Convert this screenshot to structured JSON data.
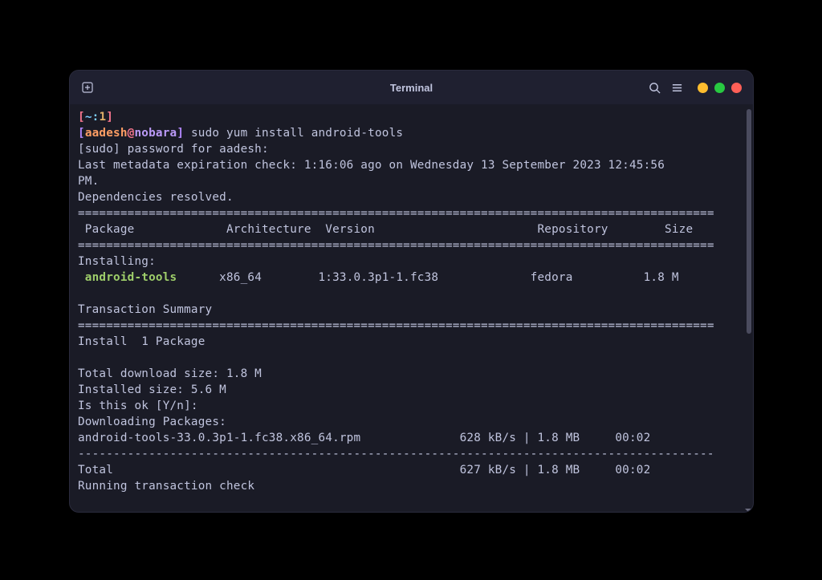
{
  "titlebar": {
    "title": "Terminal"
  },
  "prompt": {
    "open_br": "[",
    "tilde": "~",
    "colon": ":",
    "one": "1",
    "close_br": "]",
    "open_br2": "[",
    "user": "aadesh",
    "at": "@",
    "host": "nobara",
    "close_br2": "]",
    "command": " sudo yum install android-tools"
  },
  "lines": {
    "sudo_pw": "[sudo] password for aadesh:",
    "metadata": "Last metadata expiration check: 1:16:06 ago on Wednesday 13 September 2023 12:45:56",
    "pm": "PM.",
    "dep": "Dependencies resolved.",
    "dbl_sep": "==========================================================================================",
    "header": " Package             Architecture  Version                       Repository        Size",
    "installing": "Installing:",
    "pkg_name": " android-tools      ",
    "pkg_rest": "x86_64        1:33.0.3p1-1.fc38             fedora          1.8 M",
    "txn_summary": "Transaction Summary",
    "install_cnt": "Install  1 Package",
    "dlsize": "Total download size: 1.8 M",
    "instsize": "Installed size: 5.6 M",
    "ok": "Is this ok [Y/n]:",
    "downloading": "Downloading Packages:",
    "rpm": "android-tools-33.0.3p1-1.fc38.x86_64.rpm              628 kB/s | 1.8 MB     00:02",
    "dash_sep": "------------------------------------------------------------------------------------------",
    "total": "Total                                                 627 kB/s | 1.8 MB     00:02",
    "running": "Running transaction check"
  }
}
